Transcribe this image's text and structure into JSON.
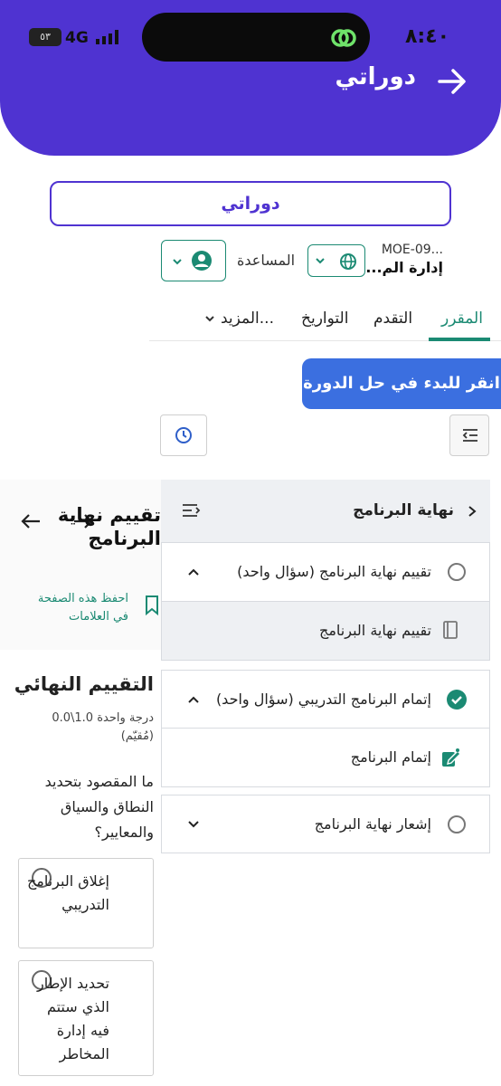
{
  "status_bar": {
    "time": "٨:٤٠",
    "network": "4G",
    "battery": "٥٣"
  },
  "header": {
    "title": "دوراتي"
  },
  "courses_button": "دوراتي",
  "org": {
    "code": "MOE-09...",
    "name": "إدارة الم..."
  },
  "help_label": "المساعدة",
  "tabs": [
    {
      "label": "المقرر",
      "active": true
    },
    {
      "label": "التقدم",
      "active": false
    },
    {
      "label": "التواريخ",
      "active": false
    },
    {
      "label": "المزيد...",
      "active": false
    }
  ],
  "resume_button": "انقر للبدء في حل الدورة",
  "outline": {
    "title": "نهاية البرنامج",
    "sections": [
      {
        "title": "تقييم نهاية البرنامج (سؤال واحد)",
        "status": "incomplete",
        "expanded": true,
        "units": [
          {
            "title": "تقييم نهاية البرنامج",
            "icon": "book-icon"
          }
        ]
      },
      {
        "title": "إتمام البرنامج التدريبي (سؤال واحد)",
        "status": "complete",
        "expanded": true,
        "units": [
          {
            "title": "إتمام البرنامج",
            "icon": "edit-icon"
          }
        ]
      },
      {
        "title": "إشعار نهاية البرنامج",
        "status": "incomplete",
        "expanded": false,
        "units": []
      }
    ]
  },
  "unit": {
    "title": "تقييم نهاية البرنامج",
    "bookmark": "احفظ هذه الصفحة في العلامات"
  },
  "problem": {
    "title": "التقييم النهائي",
    "grade": "درجة واحدة 1.0\\0.0",
    "grade_note": "(مُقيّم)",
    "question": "ما المقصود بتحديد النطاق والسياق والمعايير؟",
    "answers": [
      "إغلاق البرنامج التدريبي",
      "تحديد الإطار الذي ستتم فيه إدارة المخاطر"
    ]
  },
  "colors": {
    "brand": "#4f33d1",
    "accent": "#1b8a73",
    "resume": "#3b6fe0",
    "complete": "#1b8a73"
  }
}
